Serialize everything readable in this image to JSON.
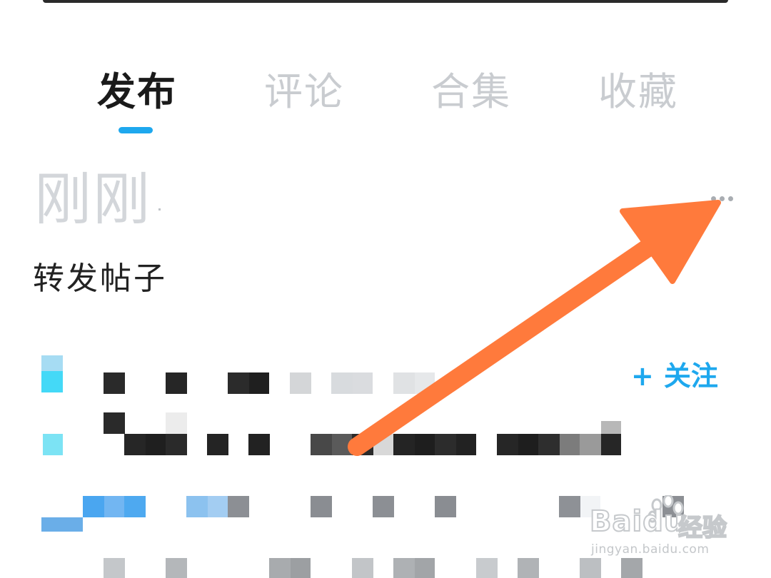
{
  "tabs": [
    {
      "label": "发布",
      "active": true
    },
    {
      "label": "评论",
      "active": false
    },
    {
      "label": "合集",
      "active": false
    },
    {
      "label": "收藏",
      "active": false
    }
  ],
  "colors": {
    "accent": "#1ea8ee",
    "active_tab_text": "#1a1a1a",
    "inactive_tab_text": "#c9ccd0",
    "annotation_arrow": "#ff7a3c"
  },
  "post": {
    "timestamp": "刚刚",
    "type_label": "转发帖子",
    "more_icon": "more-horizontal-icon",
    "follow_button": {
      "plus": "+",
      "label": "关注"
    }
  },
  "watermark": {
    "brand": "Baidu",
    "brand_cn": "经验",
    "url": "jingyan.baidu.com"
  }
}
